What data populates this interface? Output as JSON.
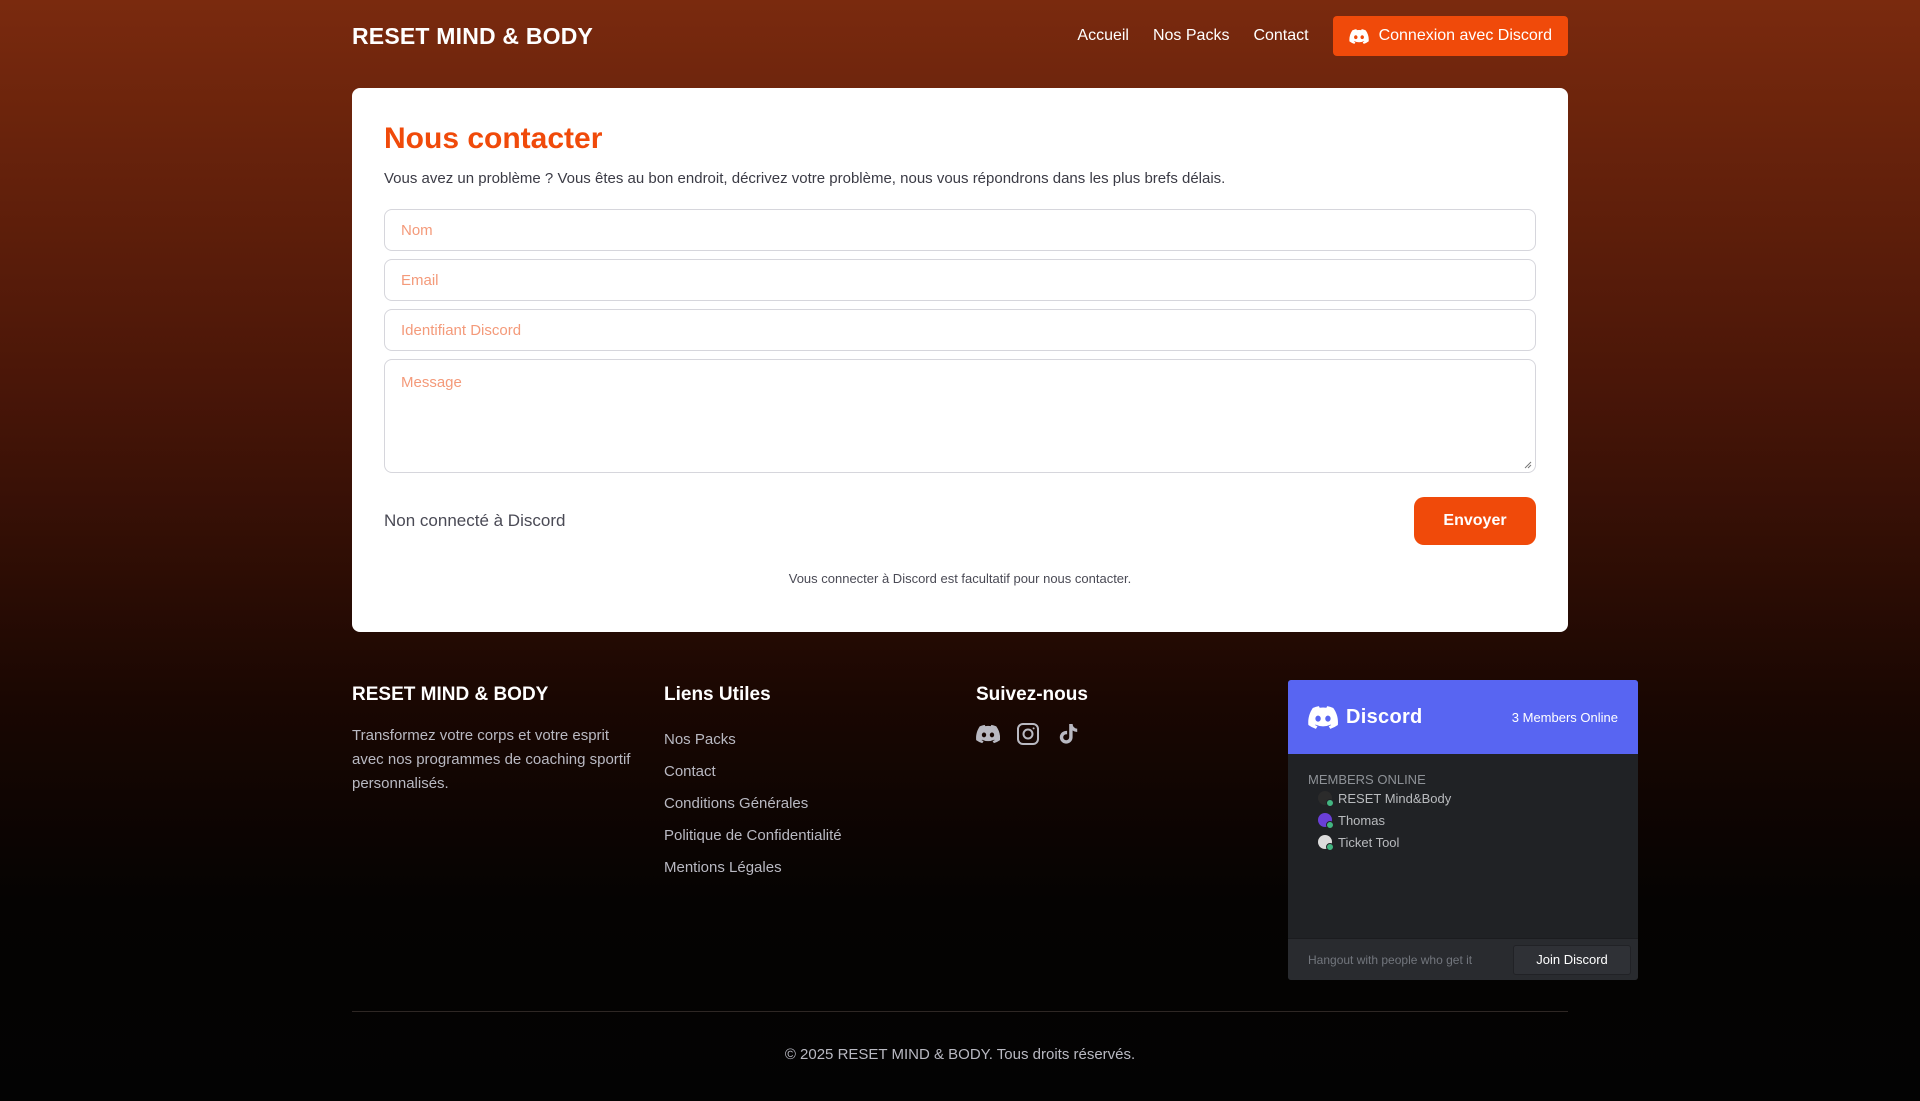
{
  "header": {
    "brand": "RESET MIND & BODY",
    "nav": [
      "Accueil",
      "Nos Packs",
      "Contact"
    ],
    "login_button": "Connexion avec Discord"
  },
  "contact": {
    "title": "Nous contacter",
    "lead": "Vous avez un problème ? Vous êtes au bon endroit, décrivez votre problème, nous vous répondrons dans les plus brefs délais.",
    "name_placeholder": "Nom",
    "email_placeholder": "Email",
    "discord_id_placeholder": "Identifiant Discord",
    "message_placeholder": "Message",
    "status": "Non connecté à Discord",
    "submit": "Envoyer",
    "note": "Vous connecter à Discord est facultatif pour nous contacter."
  },
  "footer": {
    "brand": "RESET MIND & BODY",
    "description": "Transformez votre corps et votre esprit avec nos programmes de coaching sportif personnalisés.",
    "links_title": "Liens Utiles",
    "links": [
      "Nos Packs",
      "Contact",
      "Conditions Générales",
      "Politique de Confidentialité",
      "Mentions Légales"
    ],
    "social_title": "Suivez-nous",
    "socials": [
      "discord-icon",
      "instagram-icon",
      "tiktok-icon"
    ],
    "copyright": "© 2025 RESET MIND & BODY. Tous droits réservés."
  },
  "discord_widget": {
    "logo_text": "Discord",
    "members_online": "3 Members Online",
    "section_label": "MEMBERS ONLINE",
    "members": [
      {
        "name": "RESET Mind&Body",
        "avatar_color": "#2b2b2b"
      },
      {
        "name": "Thomas",
        "avatar_color": "#6a3fd8"
      },
      {
        "name": "Ticket Tool",
        "avatar_color": "#dcdcdc"
      }
    ],
    "tagline": "Hangout with people who get it",
    "join_button": "Join Discord"
  },
  "colors": {
    "accent": "#f04a0a",
    "discord_blurple": "#5865f2"
  }
}
